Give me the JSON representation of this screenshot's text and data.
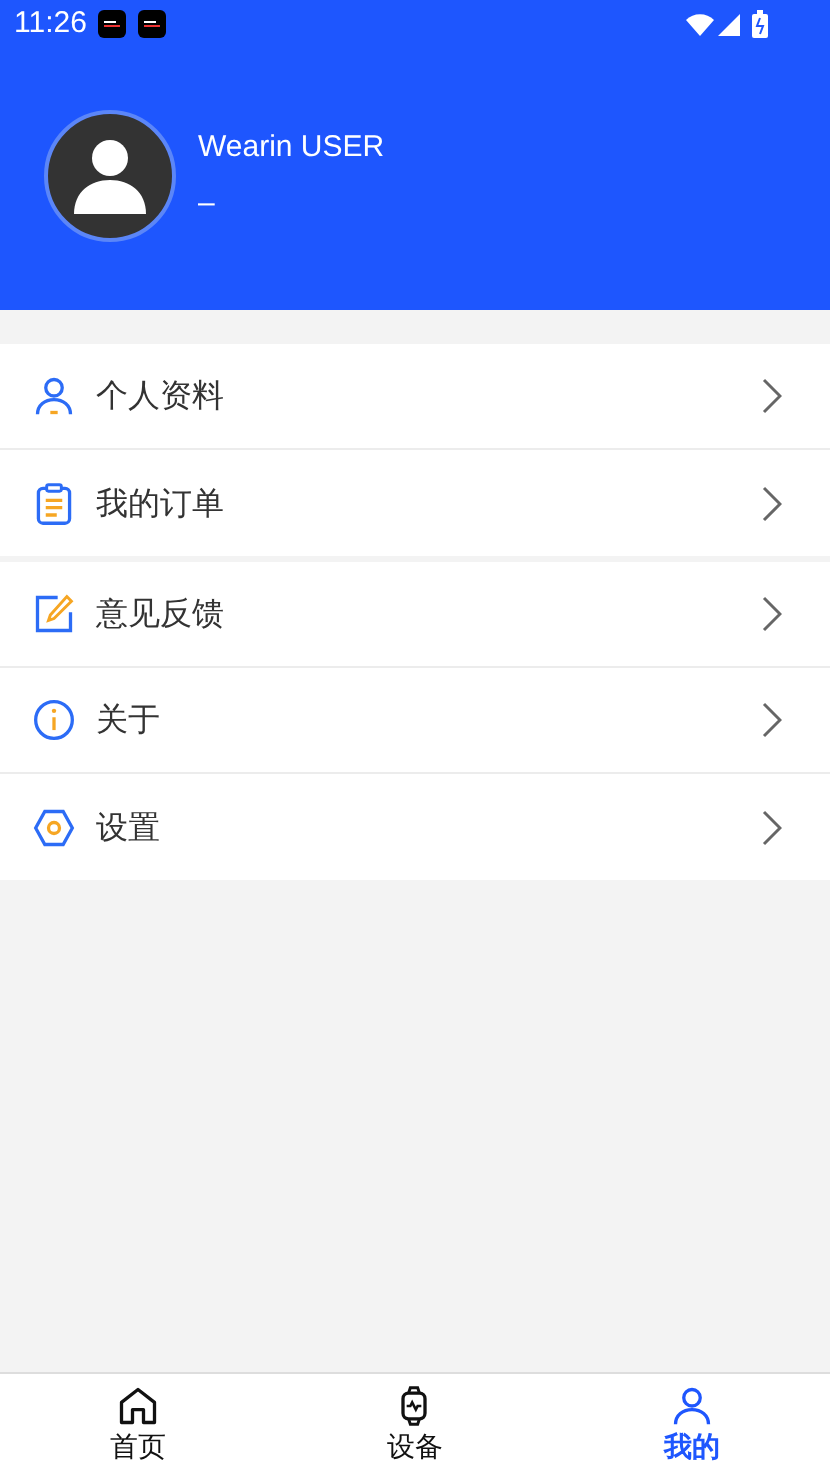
{
  "status_bar": {
    "time": "11:26"
  },
  "profile": {
    "name": "Wearin USER",
    "subtitle": "–"
  },
  "menu_groups": [
    {
      "items": [
        {
          "label": "个人资料"
        },
        {
          "label": "我的订单"
        }
      ]
    },
    {
      "items": [
        {
          "label": "意见反馈"
        },
        {
          "label": "关于"
        },
        {
          "label": "设置"
        }
      ]
    }
  ],
  "tabs": [
    {
      "label": "首页",
      "selected": false
    },
    {
      "label": "设备",
      "selected": false
    },
    {
      "label": "我的",
      "selected": true
    }
  ]
}
